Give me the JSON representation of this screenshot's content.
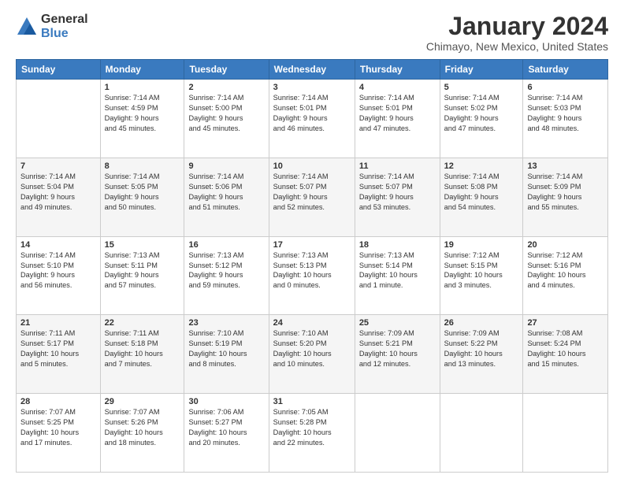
{
  "logo": {
    "general": "General",
    "blue": "Blue"
  },
  "header": {
    "title": "January 2024",
    "location": "Chimayo, New Mexico, United States"
  },
  "weekdays": [
    "Sunday",
    "Monday",
    "Tuesday",
    "Wednesday",
    "Thursday",
    "Friday",
    "Saturday"
  ],
  "weeks": [
    [
      {
        "day": "",
        "info": ""
      },
      {
        "day": "1",
        "info": "Sunrise: 7:14 AM\nSunset: 4:59 PM\nDaylight: 9 hours\nand 45 minutes."
      },
      {
        "day": "2",
        "info": "Sunrise: 7:14 AM\nSunset: 5:00 PM\nDaylight: 9 hours\nand 45 minutes."
      },
      {
        "day": "3",
        "info": "Sunrise: 7:14 AM\nSunset: 5:01 PM\nDaylight: 9 hours\nand 46 minutes."
      },
      {
        "day": "4",
        "info": "Sunrise: 7:14 AM\nSunset: 5:01 PM\nDaylight: 9 hours\nand 47 minutes."
      },
      {
        "day": "5",
        "info": "Sunrise: 7:14 AM\nSunset: 5:02 PM\nDaylight: 9 hours\nand 47 minutes."
      },
      {
        "day": "6",
        "info": "Sunrise: 7:14 AM\nSunset: 5:03 PM\nDaylight: 9 hours\nand 48 minutes."
      }
    ],
    [
      {
        "day": "7",
        "info": "Sunrise: 7:14 AM\nSunset: 5:04 PM\nDaylight: 9 hours\nand 49 minutes."
      },
      {
        "day": "8",
        "info": "Sunrise: 7:14 AM\nSunset: 5:05 PM\nDaylight: 9 hours\nand 50 minutes."
      },
      {
        "day": "9",
        "info": "Sunrise: 7:14 AM\nSunset: 5:06 PM\nDaylight: 9 hours\nand 51 minutes."
      },
      {
        "day": "10",
        "info": "Sunrise: 7:14 AM\nSunset: 5:07 PM\nDaylight: 9 hours\nand 52 minutes."
      },
      {
        "day": "11",
        "info": "Sunrise: 7:14 AM\nSunset: 5:07 PM\nDaylight: 9 hours\nand 53 minutes."
      },
      {
        "day": "12",
        "info": "Sunrise: 7:14 AM\nSunset: 5:08 PM\nDaylight: 9 hours\nand 54 minutes."
      },
      {
        "day": "13",
        "info": "Sunrise: 7:14 AM\nSunset: 5:09 PM\nDaylight: 9 hours\nand 55 minutes."
      }
    ],
    [
      {
        "day": "14",
        "info": "Sunrise: 7:14 AM\nSunset: 5:10 PM\nDaylight: 9 hours\nand 56 minutes."
      },
      {
        "day": "15",
        "info": "Sunrise: 7:13 AM\nSunset: 5:11 PM\nDaylight: 9 hours\nand 57 minutes."
      },
      {
        "day": "16",
        "info": "Sunrise: 7:13 AM\nSunset: 5:12 PM\nDaylight: 9 hours\nand 59 minutes."
      },
      {
        "day": "17",
        "info": "Sunrise: 7:13 AM\nSunset: 5:13 PM\nDaylight: 10 hours\nand 0 minutes."
      },
      {
        "day": "18",
        "info": "Sunrise: 7:13 AM\nSunset: 5:14 PM\nDaylight: 10 hours\nand 1 minute."
      },
      {
        "day": "19",
        "info": "Sunrise: 7:12 AM\nSunset: 5:15 PM\nDaylight: 10 hours\nand 3 minutes."
      },
      {
        "day": "20",
        "info": "Sunrise: 7:12 AM\nSunset: 5:16 PM\nDaylight: 10 hours\nand 4 minutes."
      }
    ],
    [
      {
        "day": "21",
        "info": "Sunrise: 7:11 AM\nSunset: 5:17 PM\nDaylight: 10 hours\nand 5 minutes."
      },
      {
        "day": "22",
        "info": "Sunrise: 7:11 AM\nSunset: 5:18 PM\nDaylight: 10 hours\nand 7 minutes."
      },
      {
        "day": "23",
        "info": "Sunrise: 7:10 AM\nSunset: 5:19 PM\nDaylight: 10 hours\nand 8 minutes."
      },
      {
        "day": "24",
        "info": "Sunrise: 7:10 AM\nSunset: 5:20 PM\nDaylight: 10 hours\nand 10 minutes."
      },
      {
        "day": "25",
        "info": "Sunrise: 7:09 AM\nSunset: 5:21 PM\nDaylight: 10 hours\nand 12 minutes."
      },
      {
        "day": "26",
        "info": "Sunrise: 7:09 AM\nSunset: 5:22 PM\nDaylight: 10 hours\nand 13 minutes."
      },
      {
        "day": "27",
        "info": "Sunrise: 7:08 AM\nSunset: 5:24 PM\nDaylight: 10 hours\nand 15 minutes."
      }
    ],
    [
      {
        "day": "28",
        "info": "Sunrise: 7:07 AM\nSunset: 5:25 PM\nDaylight: 10 hours\nand 17 minutes."
      },
      {
        "day": "29",
        "info": "Sunrise: 7:07 AM\nSunset: 5:26 PM\nDaylight: 10 hours\nand 18 minutes."
      },
      {
        "day": "30",
        "info": "Sunrise: 7:06 AM\nSunset: 5:27 PM\nDaylight: 10 hours\nand 20 minutes."
      },
      {
        "day": "31",
        "info": "Sunrise: 7:05 AM\nSunset: 5:28 PM\nDaylight: 10 hours\nand 22 minutes."
      },
      {
        "day": "",
        "info": ""
      },
      {
        "day": "",
        "info": ""
      },
      {
        "day": "",
        "info": ""
      }
    ]
  ]
}
